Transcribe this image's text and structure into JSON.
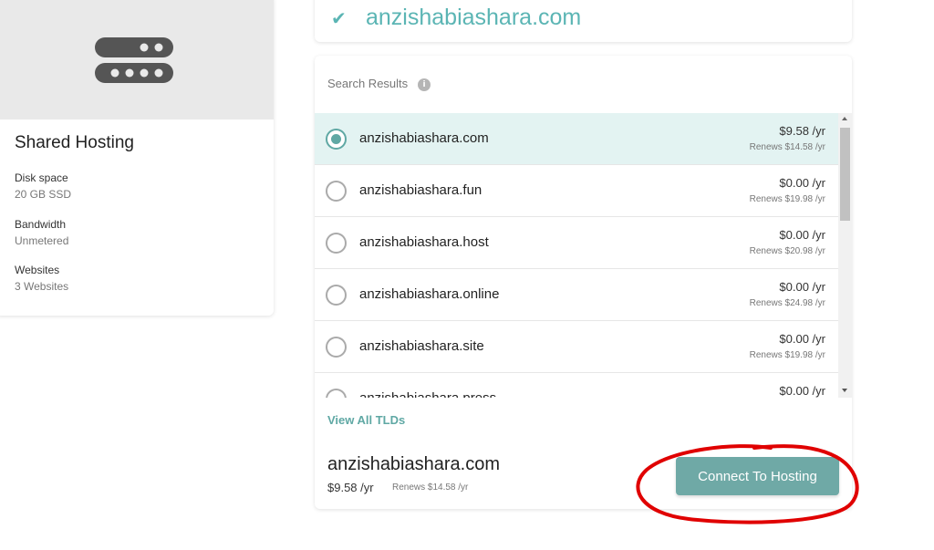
{
  "hosting": {
    "title": "Shared Hosting",
    "icon": "server-stack-icon",
    "specs": [
      {
        "label": "Disk space",
        "value": "20 GB SSD"
      },
      {
        "label": "Bandwidth",
        "value": "Unmetered"
      },
      {
        "label": "Websites",
        "value": "3 Websites"
      }
    ]
  },
  "domain": {
    "checked": "anzishabiashara.com",
    "check_icon": "check-icon"
  },
  "search": {
    "title": "Search Results",
    "info_icon": "i",
    "results": [
      {
        "name": "anzishabiashara.com",
        "price": "$9.58 /yr",
        "renew": "Renews $14.58 /yr",
        "selected": true
      },
      {
        "name": "anzishabiashara.fun",
        "price": "$0.00 /yr",
        "renew": "Renews $19.98 /yr",
        "selected": false
      },
      {
        "name": "anzishabiashara.host",
        "price": "$0.00 /yr",
        "renew": "Renews $20.98 /yr",
        "selected": false
      },
      {
        "name": "anzishabiashara.online",
        "price": "$0.00 /yr",
        "renew": "Renews $24.98 /yr",
        "selected": false
      },
      {
        "name": "anzishabiashara.site",
        "price": "$0.00 /yr",
        "renew": "Renews $19.98 /yr",
        "selected": false
      },
      {
        "name": "anzishabiashara.press",
        "price": "$0.00 /yr",
        "renew": "",
        "selected": false
      }
    ],
    "view_all": "View All TLDs"
  },
  "selection": {
    "name": "anzishabiashara.com",
    "price": "$9.58 /yr",
    "renew": "Renews $14.58 /yr",
    "connect_label": "Connect To Hosting"
  },
  "colors": {
    "accent": "#5bb5b4",
    "button": "#6fa9a6",
    "annotation": "#e00000"
  }
}
